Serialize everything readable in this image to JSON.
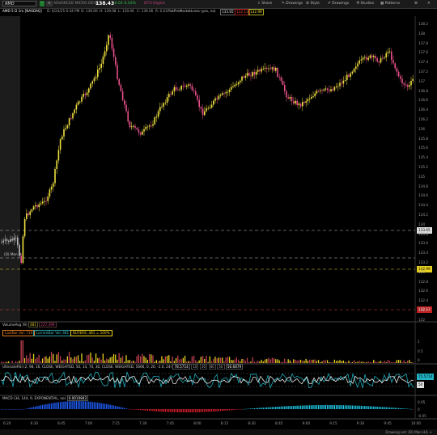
{
  "topbar": {
    "symbol": "AMD",
    "badges": [
      {
        "text": "-",
        "bg": "#1e7a2e",
        "color": "#fff"
      },
      {
        "text": "+",
        "bg": "#333",
        "color": "#ddd"
      }
    ],
    "ticker_name": "ADVANCED MICRO DEVIC",
    "last_price": "138.43",
    "change": "-0.04",
    "change_pct": "-0.03%",
    "extra_label": "DTO Digital",
    "menu": [
      "Share",
      "Drawings",
      "Style",
      "Drawings",
      "Studies",
      "Patterns"
    ]
  },
  "info": {
    "chart_title": "AMD 5 D 1m [NASDAQ]",
    "date": "D: 6/24/25 6:34 PM",
    "open": "O: 139.06",
    "high": "H: 139.08",
    "low": "L: 139.06",
    "close": "C: 139.06",
    "range": "R: 0.01",
    "study": "PlotPreMarketLines (yes, no)",
    "v1": "133.65",
    "v2": "132.13",
    "v3": "132.99",
    "colors": {
      "v1": "#e0e0e0",
      "v2": "#ff4444",
      "v3": "#f0e040"
    }
  },
  "levels": {
    "white_line": "133.65",
    "yellow_line": "132.99",
    "red_line": "132.13",
    "mon_label": "(D) Mon H"
  },
  "price_axis": [
    "138.2",
    "138",
    "137.8",
    "137.6",
    "137.4",
    "137.2",
    "137",
    "136.8",
    "136.6",
    "136.4",
    "136.2",
    "136",
    "135.8",
    "135.6",
    "135.4",
    "135.2",
    "135",
    "134.8",
    "134.6",
    "134.4",
    "134.2",
    "134",
    "133.8",
    "133.6",
    "133.4",
    "133.2",
    "133",
    "132.8",
    "132.6",
    "132.4",
    "132.2",
    "132"
  ],
  "volume": {
    "title": "VolumeAvg (9)",
    "v1": "481",
    "v2": "227,399",
    "boxes": [
      "LastBar Vol: 719",
      "CurrentBar Vol: 481",
      "BUYERS: 481 = 100%"
    ],
    "box_colors": [
      "#e07a20",
      "#2aa0a0",
      "#e8d020"
    ],
    "axis": [
      "1",
      "0.5",
      "0"
    ]
  },
  "rsi": {
    "title": "UltimateRSI (2, 98, 16, CLOSE, WEIGHTED, 50, 14, 70, 30, CLOSE, WEIGHTED, 5666, 0, 20, -2.0, 24)",
    "v1": "78.5714",
    "v2": "70",
    "v3": "30",
    "v4": "50",
    "v5": "56.6879",
    "v6": "10",
    "v7": "80",
    "axis": [
      "75.5714",
      "50"
    ]
  },
  "macd": {
    "title": "MACD (34, 144, 9, EXPONENTIAL, no)",
    "value": "0.0010842",
    "axis": [
      "0.05",
      "0",
      "-0.05"
    ]
  },
  "time_axis": [
    "6:20",
    "6:30",
    "6:45",
    "7:00",
    "7:15",
    "7:30",
    "7:45",
    "8:00",
    "8:15",
    "8:30",
    "8:45",
    "9:00",
    "9:15",
    "9:30",
    "9:45",
    "10:00"
  ],
  "status": {
    "left": "",
    "right": "Drawing set: (D) Mon H/L +"
  }
}
